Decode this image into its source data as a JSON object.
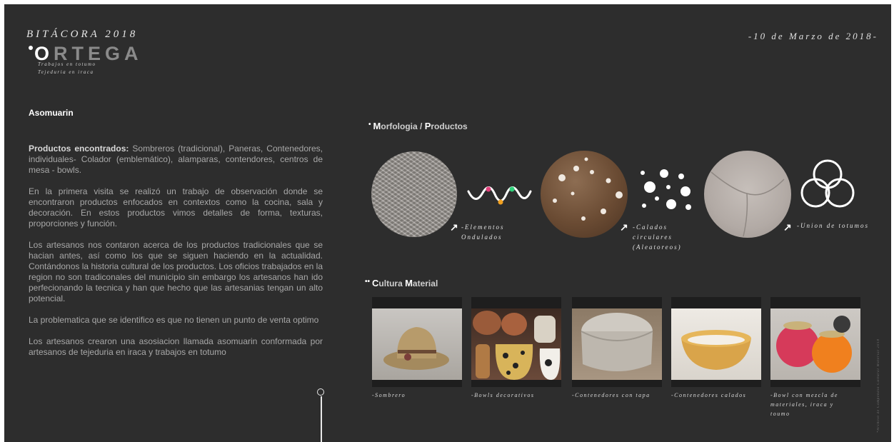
{
  "header": {
    "journal_title": "BITÁCORA 2018",
    "brand_first_letter": "O",
    "brand_rest": "RTEGA",
    "subtitle_line1": "Trabajos en totumo",
    "subtitle_line2": "Tejeduria en iraca",
    "date": "-10 de Marzo de 2018-"
  },
  "left": {
    "section_title": "Asomuarin",
    "products_label": "Productos encontrados:",
    "products_list": " Sombreros (tradicional), Paneras, Contenedores, individuales- Colador (emblemático), alamparas, contendores, centros de mesa - bowls.",
    "paragraph2": "En la primera visita se realizó un trabajo de observación donde se encontraron productos enfocados en contextos como la cocina, sala y decoración. En estos productos vimos detalles de forma, texturas, proporciones y función.",
    "paragraph3": "Los artesanos nos contaron acerca de los productos tradicionales que se hacian antes, así como los que se siguen haciendo en la actualidad. Contándonos la historia cultural de los productos. Los oficios trabajados en la region no son tradiconales del municipio sin embargo los artesanos han ido perfecionando la tecnica y han que hecho que las artesanias tengan un alto potencial.",
    "paragraph4": "La problematica que se identifico es que no tienen un punto de venta optimo",
    "paragraph5": "Los artesanos crearon una asosiacion llamada asomuarin conformada por artesanos de tejeduria en iraca y trabajos en totumo"
  },
  "morphology": {
    "title_big1": "M",
    "title_rest1": "orfologia / ",
    "title_big2": "P",
    "title_rest2": "roductos",
    "items": [
      {
        "caption_line1": "-Elementos",
        "caption_line2": "Ondulados"
      },
      {
        "caption_line1": "-Calados",
        "caption_line2": "circulares",
        "caption_line3": "(Aleatoreos)"
      },
      {
        "caption_line1": "-Union de totumos"
      }
    ]
  },
  "culture": {
    "title_big1": "C",
    "title_rest1": "ultura ",
    "title_big2": "M",
    "title_rest2": "aterial",
    "photos": [
      {
        "caption": "-Sombrero"
      },
      {
        "caption": "-Bowls decorativos"
      },
      {
        "caption": "-Contenedores con tapa"
      },
      {
        "caption": "-Contenedores calados"
      },
      {
        "caption_line1": "-Bowl con mezcla de",
        "caption_line2": "materiales, iraca y",
        "caption_line3": "toumo"
      }
    ]
  },
  "side_note": "*Archivo de Compendio Cultural Material 2018",
  "colors": {
    "background": "#2d2d2d",
    "accent_pink": "#e0407a",
    "accent_green": "#2fd07a",
    "accent_orange": "#f0a020"
  }
}
